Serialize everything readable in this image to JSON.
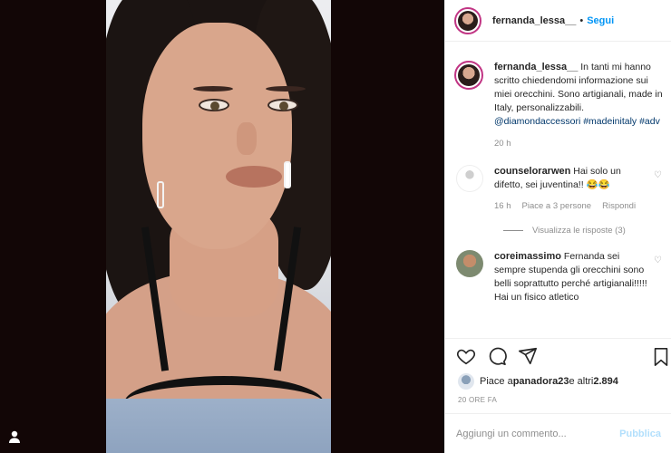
{
  "header": {
    "username": "fernanda_lessa__",
    "separator": "•",
    "follow_label": "Segui"
  },
  "caption": {
    "username": "fernanda_lessa__",
    "text": "In tanti mi hanno scritto chiedendomi informazione sui miei orecchini. Sono artigianali, made in Italy, personalizzabili.",
    "mention": "@diamondaccessori",
    "tag1": "#madeinitaly",
    "tag2": "#adv",
    "time": "20 h"
  },
  "comments": [
    {
      "username": "counselorarwen",
      "text": "Hai solo un difetto, sei juventina!! 😂😂",
      "time": "16 h",
      "likes": "Piace a 3 persone",
      "reply": "Rispondi",
      "view_replies": "Visualizza le risposte (3)"
    },
    {
      "username": "coreimassimo",
      "text": "Fernanda sei sempre stupenda gli orecchini sono belli soprattutto perché artigianali!!!!! Hai un fisico atletico"
    }
  ],
  "likes": {
    "prefix": "Piace a ",
    "user": "panadora23",
    "middle": " e altri ",
    "count": "2.894"
  },
  "timestamp": "20 ORE FA",
  "add_comment": {
    "placeholder": "Aggiungi un commento...",
    "publish_label": "Pubblica"
  },
  "icons": {
    "like": "heart-icon",
    "comment": "comment-icon",
    "share": "share-icon",
    "save": "bookmark-icon",
    "small_like": "heart-icon",
    "user": "user-icon"
  },
  "colors": {
    "accent": "#0095f6",
    "link": "#00376b",
    "muted": "#8e8e8e",
    "publish_disabled": "#b2dffc"
  }
}
